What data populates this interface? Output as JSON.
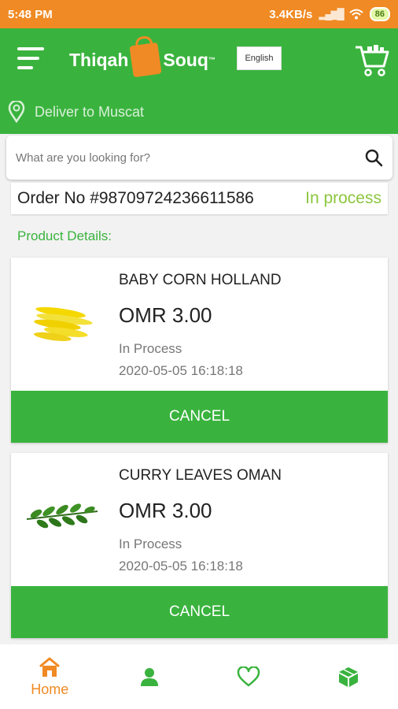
{
  "status_bar": {
    "time": "5:48 PM",
    "speed": "3.4KB/s",
    "battery": "86"
  },
  "header": {
    "brand_left": "Thiqah",
    "brand_right": "Souq",
    "lang_label": "English"
  },
  "deliver": {
    "label": "Deliver to Muscat"
  },
  "search": {
    "placeholder": "What are you looking for?"
  },
  "order": {
    "number": "Order No #98709724236611586",
    "status": "In process"
  },
  "section": {
    "label": "Product Details:"
  },
  "products": [
    {
      "name": "BABY CORN HOLLAND",
      "price": "OMR 3.00",
      "status": "In Process",
      "date": "2020-05-05 16:18:18",
      "cancel_label": "CANCEL"
    },
    {
      "name": "CURRY LEAVES OMAN",
      "price": "OMR 3.00",
      "status": "In Process",
      "date": "2020-05-05 16:18:18",
      "cancel_label": "CANCEL"
    }
  ],
  "nav": [
    {
      "icon": "home-icon",
      "label": "Home"
    },
    {
      "icon": "user-icon",
      "label": ""
    },
    {
      "icon": "heart-icon",
      "label": ""
    },
    {
      "icon": "box-icon",
      "label": ""
    }
  ],
  "colors": {
    "primary": "#3ab33e",
    "accent": "#f08a24",
    "status_text": "#8cc63f"
  }
}
